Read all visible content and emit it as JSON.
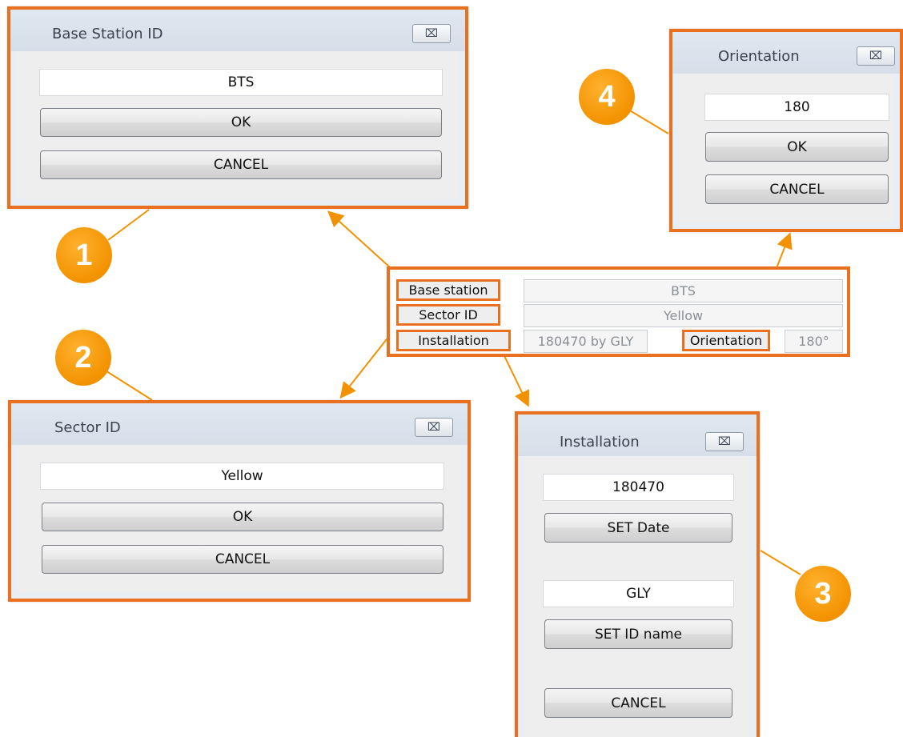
{
  "dialogs": {
    "base_station": {
      "title": "Base Station ID",
      "close": "⌧",
      "value": "BTS",
      "ok": "OK",
      "cancel": "CANCEL"
    },
    "sector": {
      "title": "Sector ID",
      "close": "⌧",
      "value": "Yellow",
      "ok": "OK",
      "cancel": "CANCEL"
    },
    "orientation": {
      "title": "Orientation",
      "close": "⌧",
      "value": "180",
      "ok": "OK",
      "cancel": "CANCEL"
    },
    "installation": {
      "title": "Installation",
      "close": "⌧",
      "date_value": "180470",
      "set_date": "SET Date",
      "id_value": "GLY",
      "set_id": "SET ID name",
      "cancel": "CANCEL"
    }
  },
  "panel": {
    "base_station_label": "Base station",
    "base_station_value": "BTS",
    "sector_label": "Sector ID",
    "sector_value": "Yellow",
    "installation_label": "Installation",
    "installation_value": "180470 by GLY",
    "orientation_label": "Orientation",
    "orientation_value": "180°"
  },
  "callouts": [
    "1",
    "2",
    "3",
    "4"
  ],
  "colors": {
    "accent": "#e8701f",
    "badge": "#f39200"
  }
}
